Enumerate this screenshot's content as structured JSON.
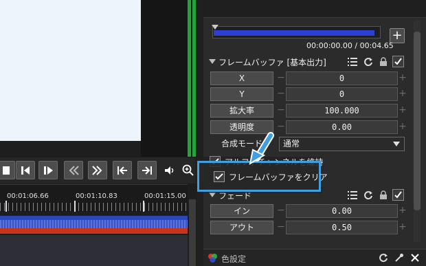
{
  "transport": {
    "buttons": [
      "stop",
      "previous-frame",
      "next-frame",
      "rewind",
      "fast-forward",
      "go-to-start",
      "go-to-end"
    ],
    "volume_icon": "speaker-icon",
    "zoom_icon": "zoom-icon"
  },
  "timeline": {
    "ticks": [
      "00:01:06.66",
      "00:01:10.83",
      "00:01:15.00"
    ]
  },
  "clip": {
    "progress": 0.97,
    "timecode": "00:00:00.00 / 00:04.65",
    "add_label": "+"
  },
  "section_buffer": {
    "title": "フレームバッファ [基本出力]",
    "params": [
      {
        "label": "X",
        "value": "0"
      },
      {
        "label": "Y",
        "value": "0"
      },
      {
        "label": "拡大率",
        "value": "100.000"
      },
      {
        "label": "透明度",
        "value": "0.00"
      }
    ],
    "blend": {
      "label": "合成モード",
      "value": "通常"
    },
    "checkboxes": [
      {
        "label": "アルファチャンネルを維持",
        "checked": true
      },
      {
        "label": "フレームバッファをクリア",
        "checked": true
      }
    ]
  },
  "section_fade": {
    "title": "フェード",
    "params": [
      {
        "label": "イン",
        "value": "0.00"
      },
      {
        "label": "アウト",
        "value": "0.50"
      }
    ]
  },
  "color_settings": {
    "label": "色設定"
  },
  "colors": {
    "accent": "#3f9fe0",
    "meter": "#22a63a",
    "audio": "#2b46b8",
    "red_track": "#c8341d"
  }
}
